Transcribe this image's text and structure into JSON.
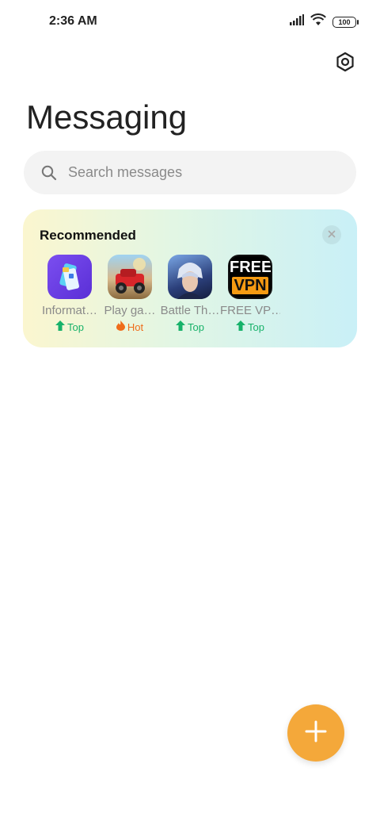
{
  "status_bar": {
    "time": "2:36 AM",
    "battery": "100",
    "icons": [
      "signal-icon",
      "wifi-icon",
      "battery-icon"
    ]
  },
  "header": {
    "title": "Messaging",
    "settings_icon": "gear-icon"
  },
  "search": {
    "placeholder": "Search messages",
    "value": ""
  },
  "recommended": {
    "title": "Recommended",
    "close_icon": "close-icon",
    "apps": [
      {
        "name": "Informat…",
        "badge": "Top",
        "badge_type": "top"
      },
      {
        "name": "Play ga…",
        "badge": "Hot",
        "badge_type": "hot"
      },
      {
        "name": "Battle Th…",
        "badge": "Top",
        "badge_type": "top"
      },
      {
        "name": "FREE VP…",
        "badge": "Top",
        "badge_type": "top",
        "icon_text_1": "FREE",
        "icon_text_2": "VPN"
      }
    ]
  },
  "fab": {
    "icon": "plus-icon",
    "color": "#f4a83a"
  },
  "colors": {
    "accent": "#f4a83a",
    "badge_top": "#17b26a",
    "badge_hot": "#ef6c1a"
  }
}
